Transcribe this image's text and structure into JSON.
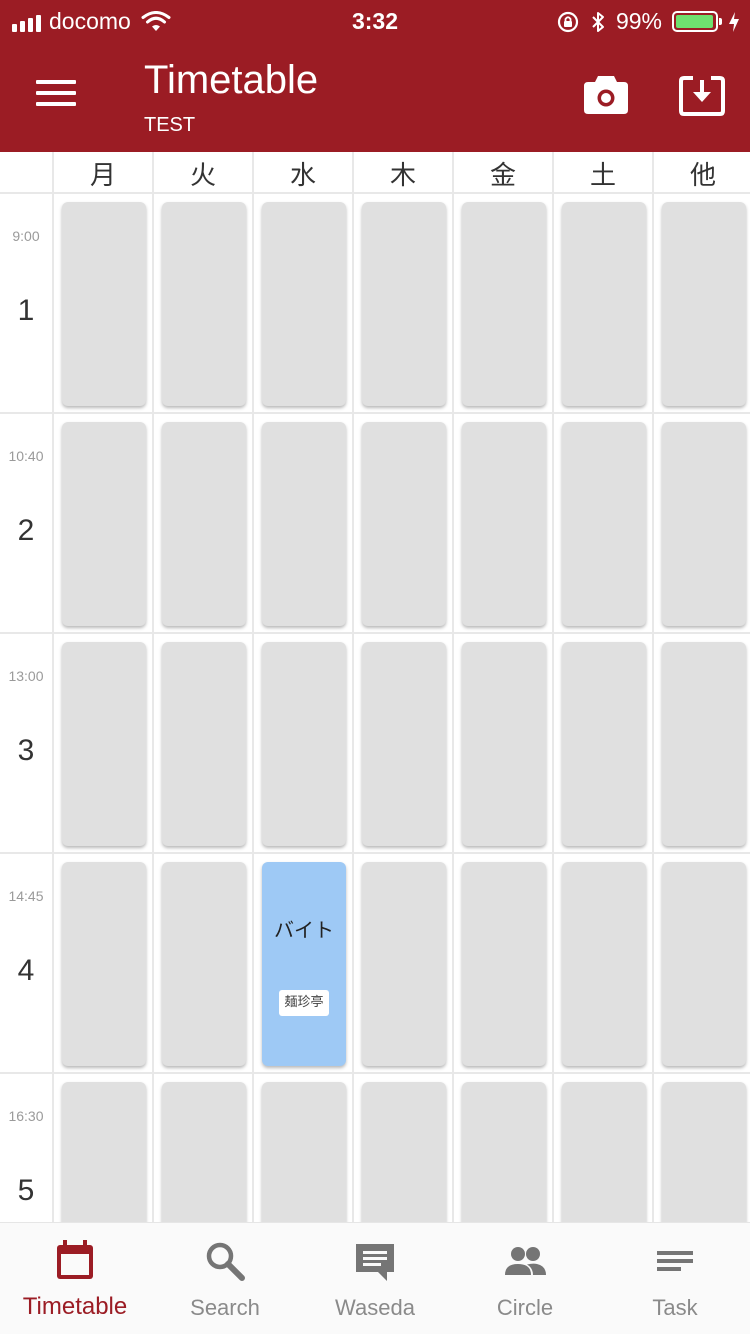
{
  "status_bar": {
    "carrier": "docomo",
    "time": "3:32",
    "battery_percent": "99%"
  },
  "app_bar": {
    "title": "Timetable",
    "subtitle": "TEST",
    "icons": {
      "menu": "hamburger-menu-icon",
      "camera": "camera-icon",
      "download": "download-icon"
    }
  },
  "timetable": {
    "days": [
      "月",
      "火",
      "水",
      "木",
      "金",
      "土",
      "他"
    ],
    "periods": [
      {
        "number": "1",
        "start": "9:00"
      },
      {
        "number": "2",
        "start": "10:40"
      },
      {
        "number": "3",
        "start": "13:00"
      },
      {
        "number": "4",
        "start": "14:45"
      },
      {
        "number": "5",
        "start": "16:30"
      }
    ],
    "entries": [
      {
        "period": "4",
        "day": "水",
        "name": "バイト",
        "room": "麺珍亭"
      }
    ]
  },
  "bottom_nav": {
    "items": [
      {
        "label": "Timetable",
        "icon": "calendar-icon",
        "active": true
      },
      {
        "label": "Search",
        "icon": "search-icon",
        "active": false
      },
      {
        "label": "Waseda",
        "icon": "chat-icon",
        "active": false
      },
      {
        "label": "Circle",
        "icon": "people-icon",
        "active": false
      },
      {
        "label": "Task",
        "icon": "notes-icon",
        "active": false
      }
    ]
  },
  "colors": {
    "primary": "#9b1c24",
    "slot_empty": "#e0e0e0",
    "slot_filled": "#9ec9f5",
    "nav_inactive": "#8a8a8a"
  }
}
